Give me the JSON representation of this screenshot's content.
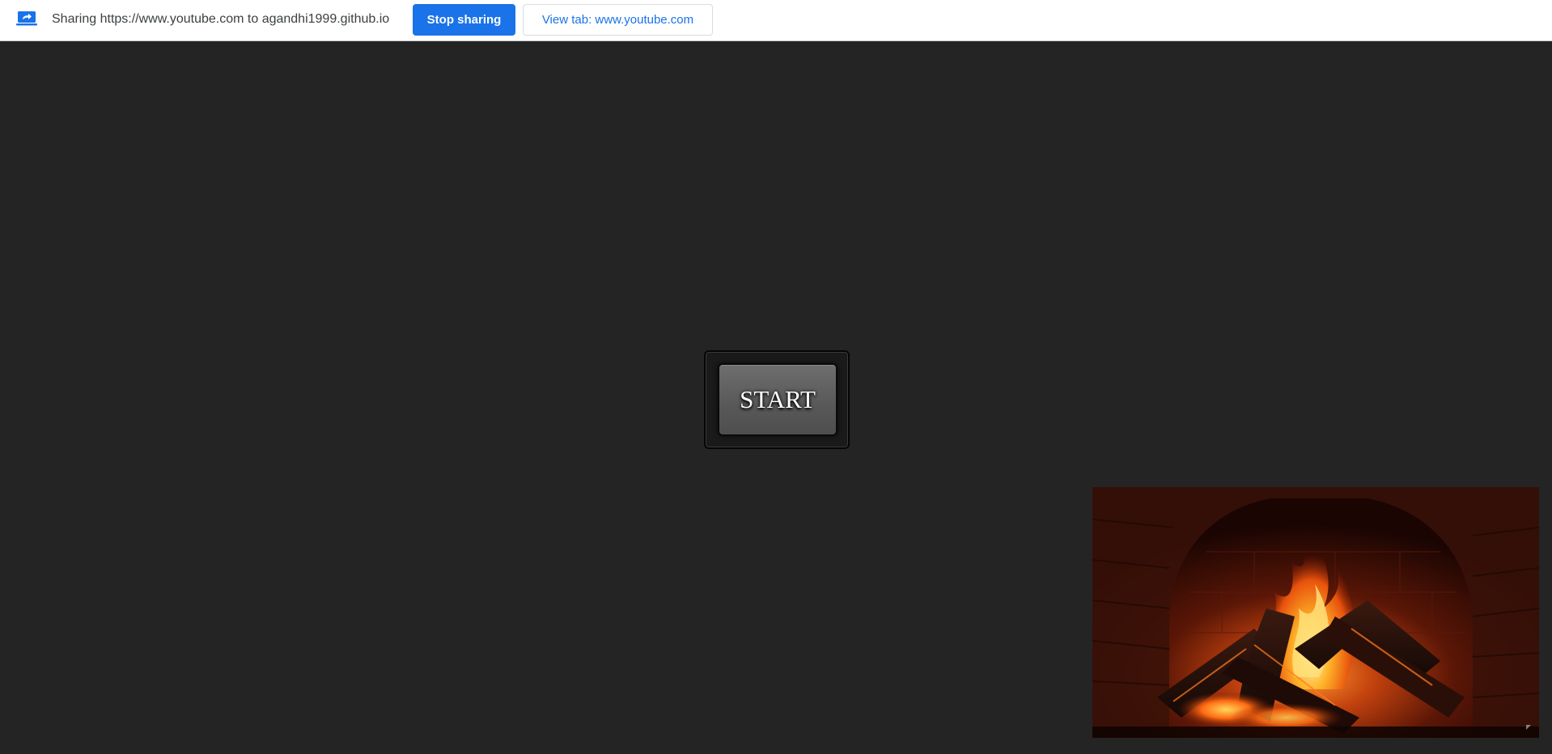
{
  "share_bar": {
    "icon": "screen-share-icon",
    "message": "Sharing https://www.youtube.com to agandhi1999.github.io",
    "stop_label": "Stop sharing",
    "view_label": "View tab: www.youtube.com"
  },
  "main": {
    "start_label": "START"
  },
  "video": {
    "icon": "resize-corner-icon"
  },
  "colors": {
    "accent": "#1a73e8",
    "page_background": "#242424",
    "share_bar_background": "#ffffff"
  }
}
